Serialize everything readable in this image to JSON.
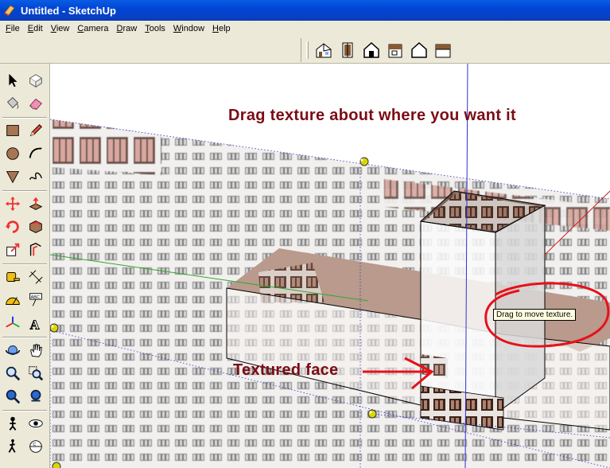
{
  "window": {
    "title": "Untitled - SketchUp"
  },
  "menu": {
    "items": [
      {
        "label": "File",
        "key": "F",
        "rest": "ile"
      },
      {
        "label": "Edit",
        "key": "E",
        "rest": "dit"
      },
      {
        "label": "View",
        "key": "V",
        "rest": "iew"
      },
      {
        "label": "Camera",
        "key": "C",
        "rest": "amera"
      },
      {
        "label": "Draw",
        "key": "D",
        "rest": "raw"
      },
      {
        "label": "Tools",
        "key": "T",
        "rest": "ools"
      },
      {
        "label": "Window",
        "key": "W",
        "rest": "indow"
      },
      {
        "label": "Help",
        "key": "H",
        "rest": "elp"
      }
    ]
  },
  "views_toolbar": {
    "buttons": [
      "iso-view-icon",
      "top-view-icon",
      "front-view-icon",
      "right-view-icon",
      "back-view-icon",
      "left-view-icon"
    ]
  },
  "tools": {
    "buttons": [
      "select-arrow-icon",
      "make-component-icon",
      "paint-bucket-icon",
      "eraser-icon",
      "rectangle-icon",
      "pencil-icon",
      "circle-icon",
      "arc-icon",
      "polygon-icon",
      "freehand-icon",
      "move-icon",
      "push-pull-icon",
      "rotate-icon",
      "follow-me-icon",
      "scale-icon",
      "offset-icon",
      "tape-measure-icon",
      "dimension-icon",
      "protractor-icon",
      "text-icon",
      "axes-icon",
      "3d-text-icon",
      "orbit-icon",
      "pan-icon",
      "zoom-icon",
      "zoom-window-icon",
      "zoom-extents-icon",
      "previous-view-icon",
      "position-camera-icon",
      "look-around-icon",
      "walk-icon",
      "section-plane-icon"
    ]
  },
  "annotations": {
    "top": "Drag texture about where you want it",
    "textured_face": "Textured face"
  },
  "tooltip": {
    "text": "Drag to move texture."
  },
  "colors": {
    "annotation_text": "#7b0c14",
    "annotation_circle": "#e8101a",
    "titlebar": "#0a5ce4",
    "chrome": "#ece9d8"
  }
}
